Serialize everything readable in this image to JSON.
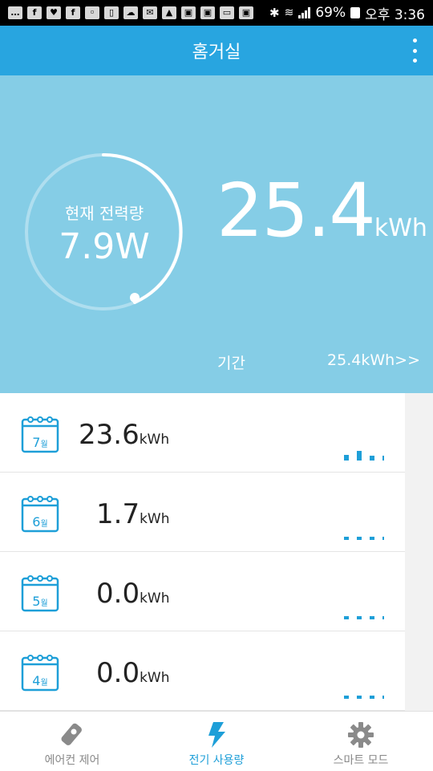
{
  "status_bar": {
    "battery": "69%",
    "time": "오후 3:36",
    "icons": [
      "chat-icon",
      "facebook-icon",
      "fitness-icon",
      "facebook-icon",
      "wechat-icon",
      "screen-icon",
      "cloud-icon",
      "mail-icon",
      "image-icon",
      "cast-icon",
      "cast-icon",
      "mmc-icon",
      "bluetooth-icon",
      "wifi-icon",
      "signal-icon",
      "battery-icon"
    ]
  },
  "appbar": {
    "title": "홈거실",
    "menu_icon": "more-vert-icon"
  },
  "hero": {
    "ring_label": "현재 전력량",
    "ring_value": "7.9W",
    "total_value": "25.4",
    "total_unit": "kWh",
    "period_label": "기간",
    "period_link": "25.4kWh>>",
    "bg_color": "#85cde6"
  },
  "months": [
    {
      "month": "7",
      "suffix": "월",
      "value": "23.6",
      "unit": "kWh",
      "bars": [
        0.35,
        0.6,
        0.3,
        0.3
      ]
    },
    {
      "month": "6",
      "suffix": "월",
      "value": "1.7",
      "unit": "kWh",
      "bars": [
        0.2,
        0.2,
        0.2,
        0.2
      ]
    },
    {
      "month": "5",
      "suffix": "월",
      "value": "0.0",
      "unit": "kWh",
      "bars": [
        0.2,
        0.2,
        0.2,
        0.2
      ]
    },
    {
      "month": "4",
      "suffix": "월",
      "value": "0.0",
      "unit": "kWh",
      "bars": [
        0.2,
        0.2,
        0.2,
        0.2
      ]
    }
  ],
  "nav": {
    "items": [
      {
        "label": "에어컨 제어",
        "icon": "remote-control-icon",
        "active": false
      },
      {
        "label": "전기 사용량",
        "icon": "lightning-icon",
        "active": true
      },
      {
        "label": "스마트 모드",
        "icon": "gear-icon",
        "active": false
      }
    ]
  },
  "colors": {
    "accent": "#28a5e0",
    "accent_text": "#1e9fd8",
    "hero": "#85cde6"
  }
}
